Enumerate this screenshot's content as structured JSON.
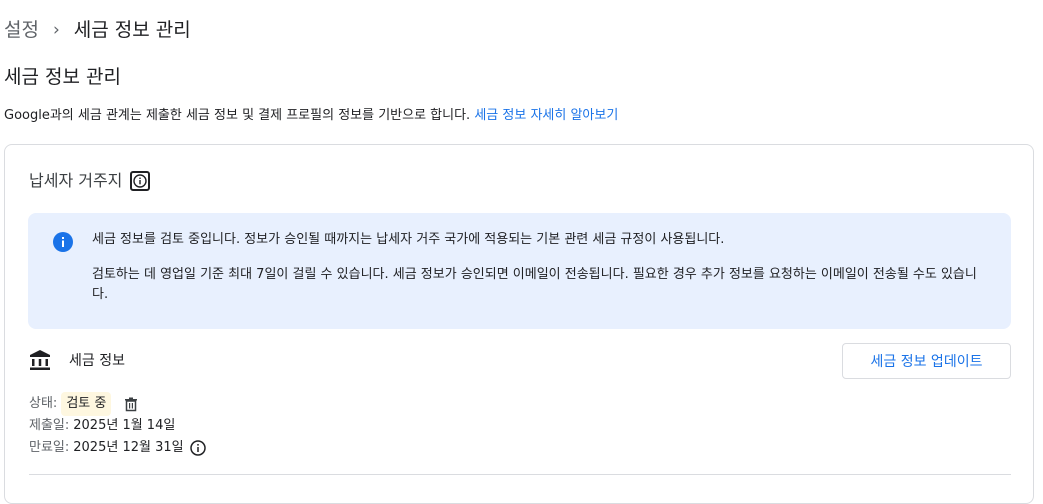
{
  "breadcrumb": {
    "parent": "설정",
    "separator": "›",
    "current": "세금 정보 관리"
  },
  "page": {
    "title": "세금 정보 관리",
    "description": "Google과의 세금 관계는 제출한 세금 정보 및 결제 프로필의 정보를 기반으로 합니다.",
    "learn_more_link": "세금 정보 자세히 알아보기"
  },
  "residency": {
    "title": "납세자 거주지"
  },
  "notice": {
    "line1": "세금 정보를 검토 중입니다. 정보가 승인될 때까지는 납세자 거주 국가에 적용되는 기본 관련 세금 규정이 사용됩니다.",
    "line2": "검토하는 데 영업일 기준 최대 7일이 걸릴 수 있습니다. 세금 정보가 승인되면 이메일이 전송됩니다. 필요한 경우 추가 정보를 요청하는 이메일이 전송될 수도 있습니다."
  },
  "tax_info": {
    "label": "세금 정보",
    "update_button": "세금 정보 업데이트",
    "status_label": "상태:",
    "status_value": "검토 중",
    "submitted_label": "제출일:",
    "submitted_value": "2025년 1월 14일",
    "expires_label": "만료일:",
    "expires_value": "2025년 12월 31일"
  },
  "colors": {
    "accent": "#1a73e8",
    "notice_bg": "#e8f0fe",
    "status_badge_bg": "#fef7e0"
  },
  "icons": {
    "residency_info": "info-icon",
    "notice": "info-filled-icon",
    "tax_info": "bank-icon",
    "delete": "trash-icon",
    "expiry_info": "info-icon"
  }
}
